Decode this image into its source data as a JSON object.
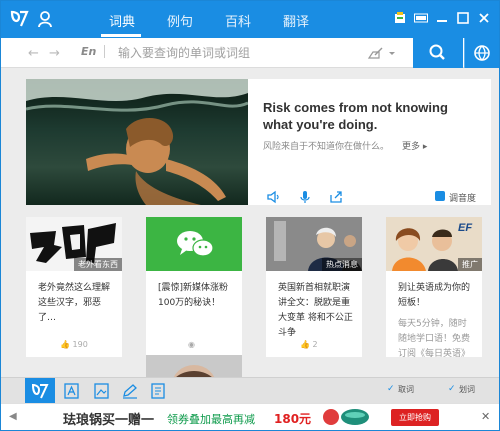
{
  "titlebar": {
    "tabs": [
      {
        "label": "词典",
        "active": true
      },
      {
        "label": "例句",
        "active": false
      },
      {
        "label": "百科",
        "active": false
      },
      {
        "label": "翻译",
        "active": false
      }
    ]
  },
  "search": {
    "lang": "En",
    "placeholder": "输入要查询的单词或词组"
  },
  "hero": {
    "quote": "Risk comes from not knowing what you're doing.",
    "cn": "风险来自于不知道你在做什么。",
    "more": "更多",
    "check_label": "调音度"
  },
  "cards": [
    {
      "tag": "老外看东西",
      "title": "老外竟然这么理解这些汉字，邪恶了…",
      "meta": "190"
    },
    {
      "tag": "",
      "title": "[震惊]新媒体涨粉100万的秘诀！",
      "meta": ""
    },
    {
      "tag": "热点消息",
      "title": "英国新首相就职演讲全文：脱欧是重大变革 将和不公正斗争",
      "meta": "2"
    },
    {
      "tag": "推广",
      "title": "别让英语成为你的短板！",
      "subtitle": "每天5分钟，随时随地学口语！免费订阅《每日英语》",
      "meta": ""
    }
  ],
  "bottombar": {
    "options": [
      "取词",
      "划词"
    ]
  },
  "ad": {
    "text": "珐琅锅买一赠一",
    "sub": "领券叠加最高再减",
    "price": "180元",
    "button": "立即抢购"
  },
  "colors": {
    "accent": "#1a8de3",
    "green": "#3cb543",
    "price": "#e02020"
  }
}
